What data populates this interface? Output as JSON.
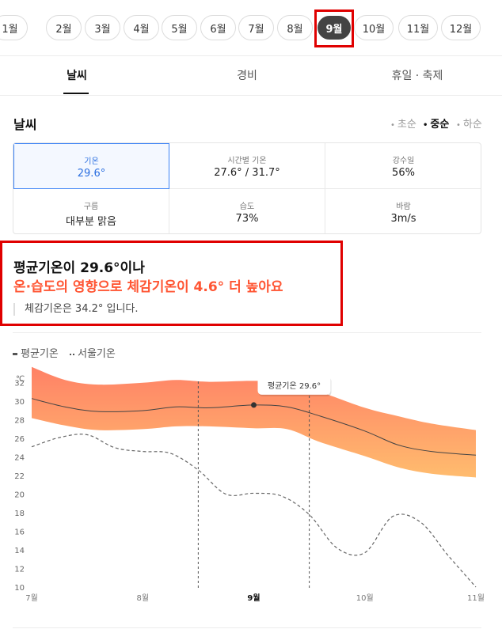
{
  "months": {
    "items": [
      {
        "label": "1월"
      },
      {
        "label": "2월"
      },
      {
        "label": "3월"
      },
      {
        "label": "4월"
      },
      {
        "label": "5월"
      },
      {
        "label": "6월"
      },
      {
        "label": "7월"
      },
      {
        "label": "8월"
      },
      {
        "label": "9월"
      },
      {
        "label": "10월"
      },
      {
        "label": "11월"
      },
      {
        "label": "12월"
      }
    ],
    "selected": "9월"
  },
  "tabs": [
    {
      "label": "날씨"
    },
    {
      "label": "경비"
    },
    {
      "label": "휴일 · 축제"
    }
  ],
  "weather": {
    "title": "날씨",
    "periods": [
      {
        "label": "초순"
      },
      {
        "label": "중순"
      },
      {
        "label": "하순"
      }
    ],
    "selected_period": "중순",
    "cells": [
      {
        "label": "기온",
        "value": "29.6°"
      },
      {
        "label": "시간별 기온",
        "value": "27.6° / 31.7°"
      },
      {
        "label": "강수일",
        "value": "56%"
      },
      {
        "label": "구름",
        "value": "대부분 맑음"
      },
      {
        "label": "습도",
        "value": "73%"
      },
      {
        "label": "바람",
        "value": "3m/s"
      }
    ]
  },
  "summary": {
    "line1": "평균기온이 29.6°이나",
    "line2": "온·습도의 영향으로 체감기온이 4.6° 더 높아요",
    "line3": "체감기온은 34.2° 입니다."
  },
  "legend": {
    "avg": "평균기온",
    "seoul": "서울기온"
  },
  "colors": {
    "band_top": "#ff8166",
    "band_bottom": "#ffbc6e",
    "highlight": "#e00000",
    "accent_blue": "#2b6fe0",
    "summary_red": "#ff5533"
  },
  "chart_data": {
    "type": "area",
    "y_unit_label": "℃",
    "ylim": [
      10,
      33
    ],
    "yticks": [
      10,
      12,
      14,
      16,
      18,
      20,
      22,
      24,
      26,
      28,
      30,
      32
    ],
    "x_range": [
      7,
      11
    ],
    "xticks": [
      {
        "x": 7,
        "label": "7월"
      },
      {
        "x": 8,
        "label": "8월"
      },
      {
        "x": 9,
        "label": "9월",
        "bold": true
      },
      {
        "x": 10,
        "label": "10월"
      },
      {
        "x": 11,
        "label": "11월"
      }
    ],
    "highlight_range": [
      8.5,
      9.5
    ],
    "tooltip": {
      "label": "평균기온 29.6°",
      "x": 9,
      "y": 29.6
    },
    "series": [
      {
        "name": "평균기온",
        "x": [
          7.0,
          7.3,
          7.6,
          8.0,
          8.3,
          8.6,
          9.0,
          9.3,
          9.6,
          10.0,
          10.3,
          10.6,
          11.0
        ],
        "y": [
          30.3,
          29.4,
          28.9,
          29.0,
          29.4,
          29.3,
          29.6,
          29.4,
          28.4,
          26.8,
          25.3,
          24.6,
          24.2
        ],
        "upper": [
          33.7,
          32.3,
          31.8,
          32.0,
          32.3,
          32.1,
          32.2,
          32.0,
          31.0,
          29.3,
          28.4,
          27.6,
          26.9
        ],
        "lower": [
          28.2,
          27.4,
          26.9,
          27.0,
          27.3,
          27.3,
          27.1,
          27.0,
          25.6,
          24.1,
          22.9,
          22.2,
          21.8
        ]
      },
      {
        "name": "서울기온",
        "x": [
          7.0,
          7.25,
          7.5,
          7.75,
          8.0,
          8.25,
          8.5,
          8.75,
          9.0,
          9.25,
          9.5,
          9.75,
          10.0,
          10.25,
          10.5,
          10.75,
          11.0
        ],
        "y": [
          25.1,
          26.1,
          26.4,
          25.0,
          24.6,
          24.4,
          22.6,
          20.0,
          20.1,
          19.8,
          17.8,
          14.2,
          13.7,
          17.6,
          17.0,
          13.4,
          10.0
        ]
      }
    ]
  }
}
